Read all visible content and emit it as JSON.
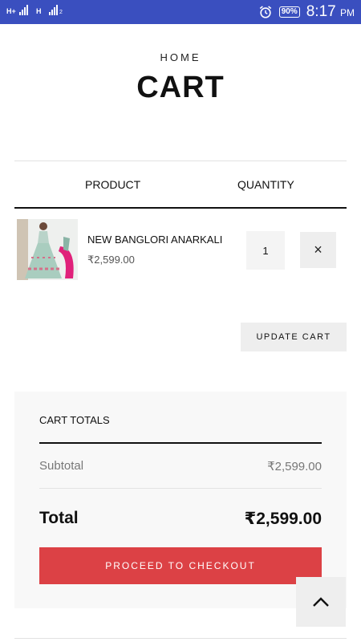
{
  "status_bar": {
    "network_1": "H+",
    "network_2": "H",
    "sim_2_index": "2",
    "battery": "90%",
    "time": "8:17",
    "time_suffix": "PM"
  },
  "header": {
    "breadcrumb": "HOME",
    "title": "CART"
  },
  "table": {
    "columns": [
      "PRODUCT",
      "QUANTITY"
    ]
  },
  "cart_items": [
    {
      "name": "NEW BANGLORI ANARKALI",
      "price": "₹2,599.00",
      "quantity": "1",
      "remove_icon": "×"
    }
  ],
  "actions": {
    "update_cart": "UPDATE CART"
  },
  "totals": {
    "title": "CART TOTALS",
    "subtotal_label": "Subtotal",
    "subtotal_value": "₹2,599.00",
    "total_label": "Total",
    "total_value": "₹2,599.00",
    "checkout_label": "PROCEED TO CHECKOUT"
  },
  "colors": {
    "status_bar": "#3a4fbf",
    "checkout_button": "#dc4145",
    "panel_background": "#f8f8f8"
  },
  "icons": {
    "remove": "close-icon",
    "back_to_top": "chevron-up-icon",
    "alarm": "alarm-clock-icon"
  }
}
